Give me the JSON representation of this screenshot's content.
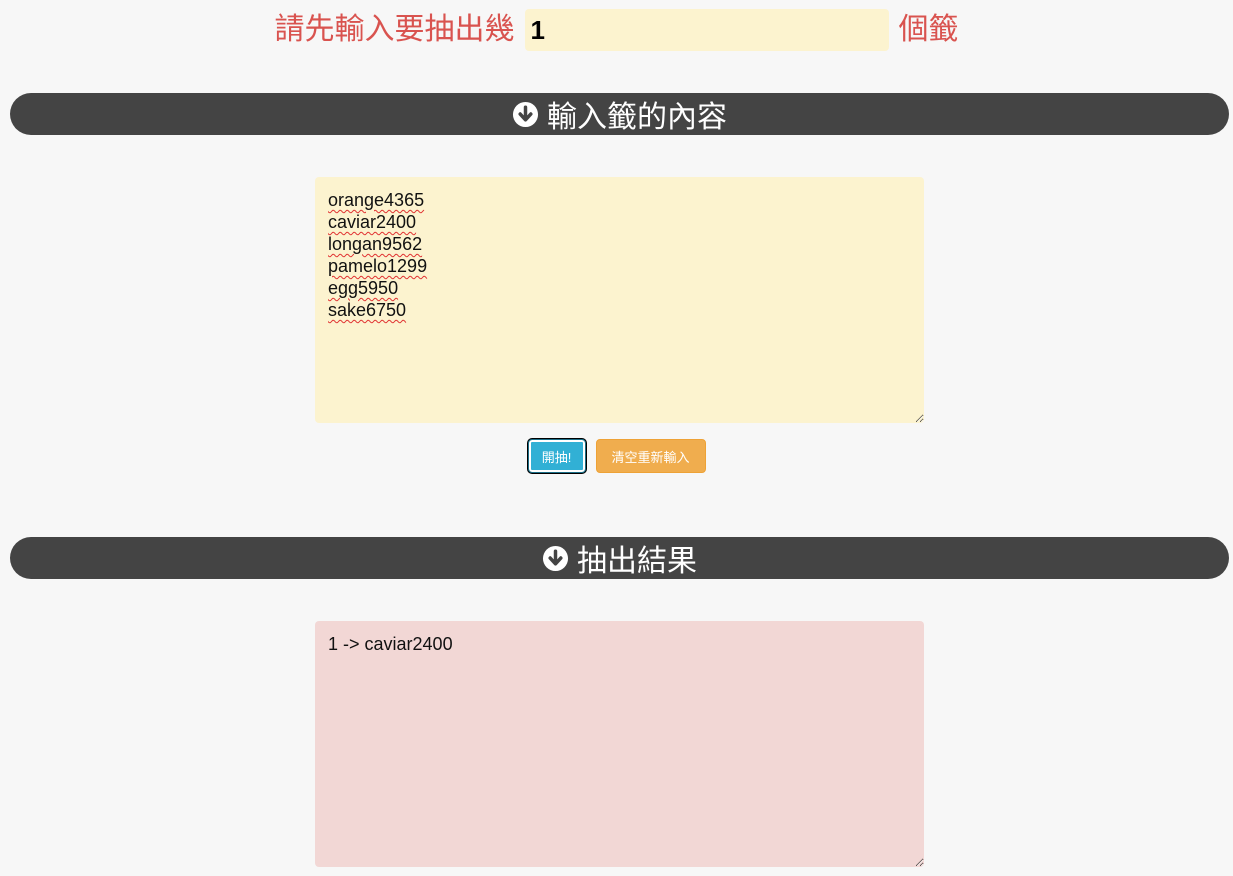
{
  "count": {
    "prefix": "請先輸入要抽出幾",
    "value": "1",
    "suffix": "個籤"
  },
  "input_section": {
    "header": "輸入籤的內容",
    "icon": "arrow-circle-down-icon",
    "tickets": "orange4365\ncaviar2400\nlongan9562\npamelo1299\negg5950\nsake6750"
  },
  "buttons": {
    "draw_label": "開抽!",
    "clear_label": "清空重新輸入"
  },
  "result_section": {
    "header": "抽出結果",
    "icon": "arrow-circle-down-icon",
    "result": "1 -> caviar2400"
  },
  "colors": {
    "label_red": "#d9534f",
    "header_bg": "#444444",
    "input_bg": "#fcf3cf",
    "result_bg": "#f2d7d5",
    "draw_button": "#31b0d5",
    "clear_button": "#f0ad4e"
  }
}
